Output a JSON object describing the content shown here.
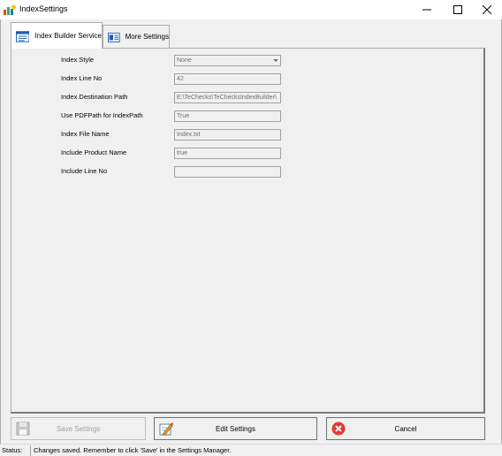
{
  "window": {
    "title": "IndexSettings"
  },
  "tabs": [
    {
      "label": "Index Builder Service",
      "active": true
    },
    {
      "label": "More Settings",
      "active": false
    }
  ],
  "properties": [
    {
      "label": "Index Style",
      "value": "None",
      "type": "select"
    },
    {
      "label": "Index Line No",
      "value": "42",
      "type": "text"
    },
    {
      "label": "Index Destination Path",
      "value": "E:\\TeChecks\\TeChecksIndexBuilder\\",
      "type": "text"
    },
    {
      "label": "Use PDFPath for IndexPath",
      "value": "True",
      "type": "text"
    },
    {
      "label": "Index File Name",
      "value": "Index.txt",
      "type": "text"
    },
    {
      "label": "Include Product Name",
      "value": "true",
      "type": "text"
    },
    {
      "label": "Include Line No",
      "value": "",
      "type": "text"
    }
  ],
  "buttons": {
    "save": "Save Settings",
    "edit": "Edit Settings",
    "cancel": "Cancel"
  },
  "status": {
    "label": "Status:",
    "message": "Changes saved. Remember to click 'Save' in the Settings Manager."
  },
  "colors": {
    "cancel_icon": "#e53935",
    "tab_icon_blue": "#1e5fb4"
  }
}
